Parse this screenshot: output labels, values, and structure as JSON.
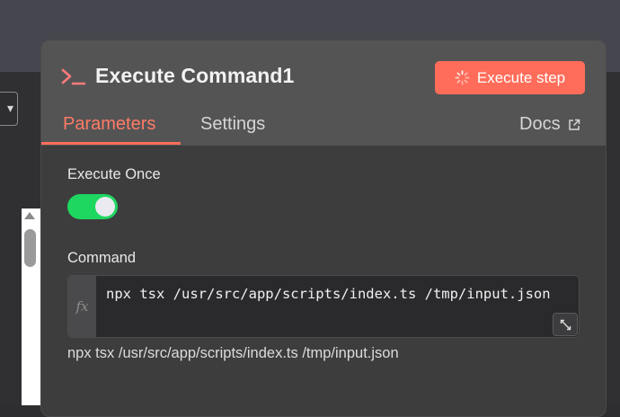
{
  "node": {
    "title": "Execute Command1",
    "execute_label": "Execute step"
  },
  "tabs": {
    "parameters": "Parameters",
    "settings": "Settings",
    "docs": "Docs"
  },
  "params": {
    "execute_once_label": "Execute Once",
    "execute_once_value": true,
    "command_label": "Command",
    "command_value": "npx tsx /usr/src/app/scripts/index.ts /tmp/input.json",
    "command_preview": "npx tsx /usr/src/app/scripts/index.ts /tmp/input.json",
    "fx_label": "fx"
  },
  "colors": {
    "accent": "#ff6d5a",
    "toggle_on": "#1ed760",
    "panel_bg": "#3d3d3e",
    "header_bg": "#545455"
  },
  "icons": {
    "node_icon": "terminal-icon",
    "execute_icon": "spinner-icon",
    "docs_icon": "external-link-icon",
    "expand_icon": "expand-icon",
    "dropdown_icon": "chevron-down-icon"
  }
}
